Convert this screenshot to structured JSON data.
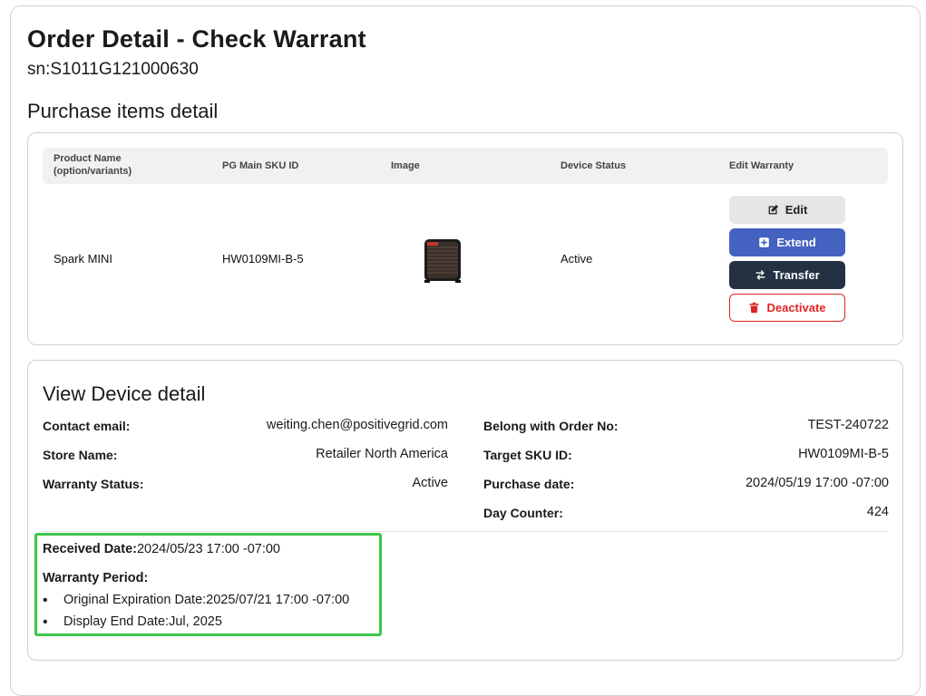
{
  "page": {
    "title": "Order Detail - Check Warrant",
    "sn": "sn:S1011G121000630",
    "purchase_section_title": "Purchase items detail"
  },
  "table": {
    "headers": {
      "product_name_line1": "Product Name",
      "product_name_line2": "(option/variants)",
      "sku": "PG Main SKU ID",
      "image": "Image",
      "status": "Device Status",
      "edit": "Edit Warranty"
    },
    "row": {
      "product_name": "Spark MINI",
      "sku": "HW0109MI-B-5",
      "status": "Active"
    },
    "actions": {
      "edit": "Edit",
      "extend": "Extend",
      "transfer": "Transfer",
      "deactivate": "Deactivate"
    }
  },
  "device": {
    "title": "View Device detail",
    "left": [
      {
        "label": "Contact email:",
        "value": "weiting.chen@positivegrid.com"
      },
      {
        "label": "Store Name:",
        "value": "Retailer North America"
      },
      {
        "label": "Warranty Status:",
        "value": "Active"
      }
    ],
    "right": [
      {
        "label": "Belong with Order No:",
        "value": "TEST-240722"
      },
      {
        "label": "Target SKU ID:",
        "value": "HW0109MI-B-5"
      },
      {
        "label": "Purchase date:",
        "value": "2024/05/19 17:00 -07:00"
      },
      {
        "label": "Day Counter:",
        "value": "424"
      }
    ],
    "received_label": "Received Date:",
    "received_value": "2024/05/23 17:00 -07:00",
    "warranty_period_label": "Warranty Period:",
    "bullets": [
      {
        "label": "Original Expiration Date:",
        "value": "2025/07/21 17:00 -07:00"
      },
      {
        "label": "Display End Date:",
        "value": "Jul, 2025"
      }
    ]
  },
  "colors": {
    "extend": "#4462c0",
    "transfer": "#233142",
    "deactivate": "#e02424",
    "highlight": "#3cc64a"
  }
}
